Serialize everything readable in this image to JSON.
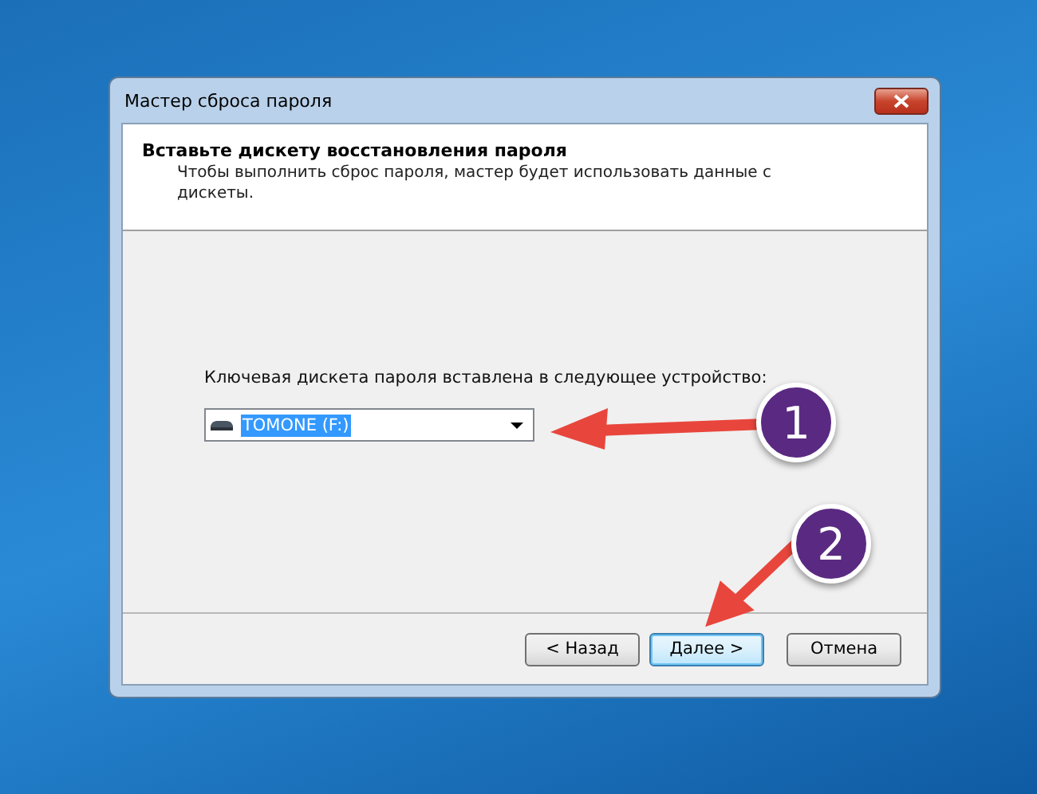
{
  "window": {
    "title": "Мастер сброса пароля"
  },
  "header": {
    "title": "Вставьте дискету восстановления пароля",
    "description": "Чтобы выполнить сброс пароля, мастер будет использовать данные с дискеты."
  },
  "device_label": "Ключевая дискета пароля вставлена в следующее устройство:",
  "device_select": {
    "value": "TOMONE (F:)"
  },
  "buttons": [
    {
      "label": "< Назад",
      "default": false
    },
    {
      "label": "Далее >",
      "default": true
    },
    {
      "label": "Отмена",
      "default": false
    }
  ],
  "annotations": [
    {
      "label": "1"
    },
    {
      "label": "2"
    }
  ]
}
